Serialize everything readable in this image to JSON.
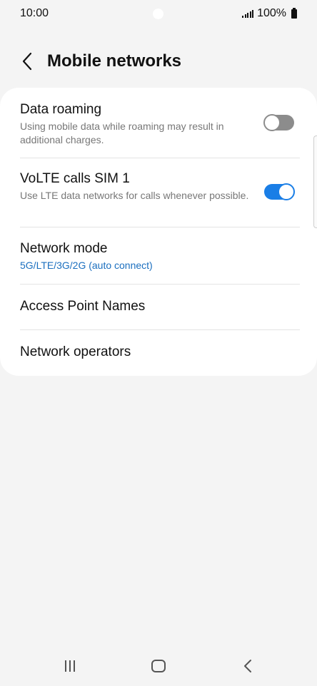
{
  "status_bar": {
    "time": "10:00",
    "battery": "100%"
  },
  "header": {
    "title": "Mobile networks"
  },
  "settings": {
    "data_roaming": {
      "title": "Data roaming",
      "description": "Using mobile data while roaming may result in additional charges.",
      "enabled": false
    },
    "volte": {
      "title": "VoLTE calls SIM 1",
      "description": "Use LTE data networks for calls whenever possible.",
      "enabled": true
    },
    "network_mode": {
      "title": "Network mode",
      "value": "5G/LTE/3G/2G (auto connect)"
    },
    "access_point_names": {
      "title": "Access Point Names"
    },
    "network_operators": {
      "title": "Network operators"
    }
  },
  "colors": {
    "accent": "#1a7ee6",
    "value_text": "#1b6fbf",
    "toggle_off": "#8c8c8c",
    "background": "#f4f4f4",
    "card": "#ffffff"
  },
  "icons": {
    "back": "chevron-left-icon",
    "recents": "recent-apps-icon",
    "home": "home-icon",
    "nav_back": "back-icon"
  }
}
